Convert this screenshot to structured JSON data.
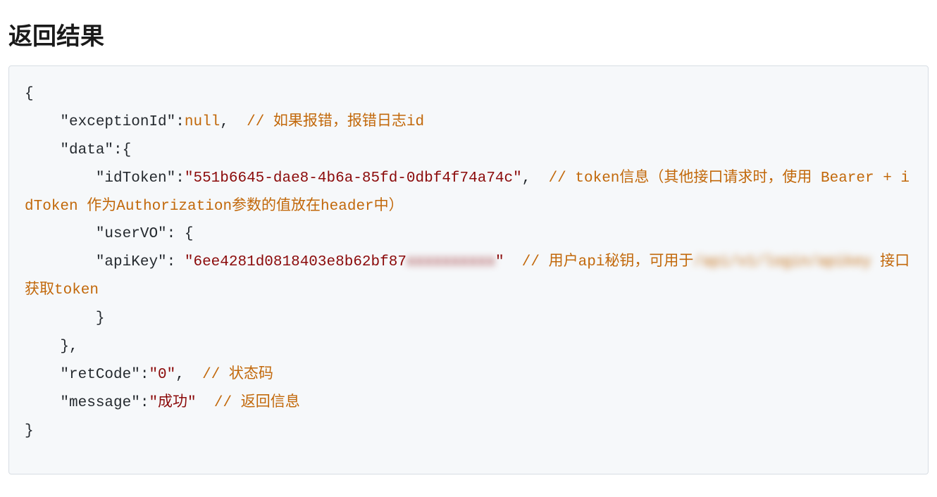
{
  "heading": "返回结果",
  "code": {
    "line1_open": "{",
    "line2_key": "\"exceptionId\"",
    "line2_val": "null",
    "line2_comma": ",",
    "line2_comment": "// 如果报错，报错日志id",
    "line3_key": "\"data\"",
    "line3_open": ":{",
    "line4_key": "\"idToken\"",
    "line4_val": "\"551b6645-dae8-4b6a-85fd-0dbf4f74a74c\"",
    "line4_comma": ",",
    "line4_comment_a": "// token信息（其他接口请求时，使用 Bearer + idToken 作为Authorization参数的值放在header中）",
    "line5_key": "\"userVO\"",
    "line5_open": ": {",
    "line6_key": "\"apiKey\"",
    "line6_val_visible": "\"6ee4281d0818403e8b62bf87",
    "line6_val_blur": "xxxxxxxxxx",
    "line6_val_close": "\"",
    "line6_comment_a": "// 用户api秘钥，可用于",
    "line6_blur_path": "/api/v1/login/apikey",
    "line6_comment_b": " 接口获取token",
    "line7_close": "}",
    "line8_close": "},",
    "line9_key": "\"retCode\"",
    "line9_val": "\"0\"",
    "line9_comma": ",",
    "line9_comment": "// 状态码",
    "line10_key": "\"message\"",
    "line10_val": "\"成功\"",
    "line10_comment": "// 返回信息",
    "line11_close": "}"
  }
}
